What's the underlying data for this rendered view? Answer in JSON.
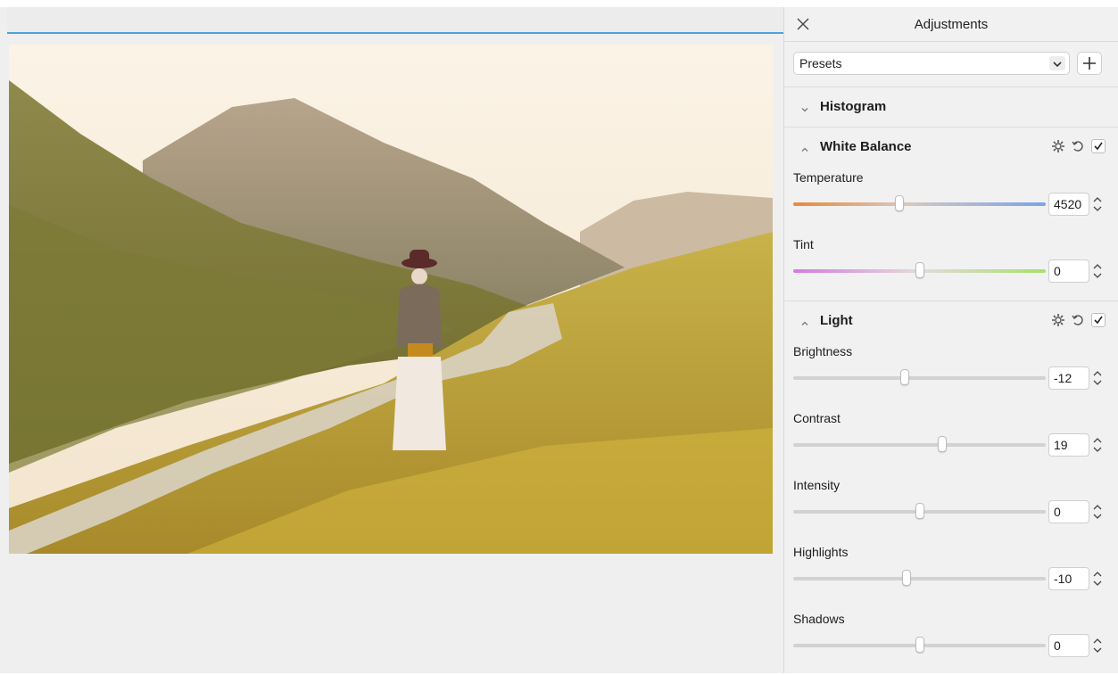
{
  "panel": {
    "title": "Adjustments",
    "presets": {
      "selected": "Presets"
    }
  },
  "sections": {
    "histogram": {
      "title": "Histogram",
      "expanded": false
    },
    "white_balance": {
      "title": "White Balance",
      "expanded": true,
      "enabled": true,
      "sliders": [
        {
          "label": "Temperature",
          "value": "4520",
          "position": 0.42,
          "track_colors": [
            "#e88a3a",
            "#7aa3ea"
          ]
        },
        {
          "label": "Tint",
          "value": "0",
          "position": 0.5,
          "track_colors": [
            "#d47be0",
            "#a8e06a"
          ]
        }
      ]
    },
    "light": {
      "title": "Light",
      "expanded": true,
      "enabled": true,
      "sliders": [
        {
          "label": "Brightness",
          "value": "-12",
          "position": 0.44
        },
        {
          "label": "Contrast",
          "value": "19",
          "position": 0.59
        },
        {
          "label": "Intensity",
          "value": "0",
          "position": 0.5
        },
        {
          "label": "Highlights",
          "value": "-10",
          "position": 0.45
        },
        {
          "label": "Shadows",
          "value": "0",
          "position": 0.5
        }
      ]
    }
  },
  "icons": {
    "close": "close-icon",
    "add": "plus-icon",
    "chevron": "chevron-down-icon",
    "gear": "gear-icon",
    "reset": "reset-icon",
    "check": "checkmark-icon",
    "stepper": "stepper-icon"
  },
  "colors": {
    "accent": "#4aa3e0",
    "panel_bg": "#f1f1f1",
    "canvas_bg": "#efefef"
  }
}
